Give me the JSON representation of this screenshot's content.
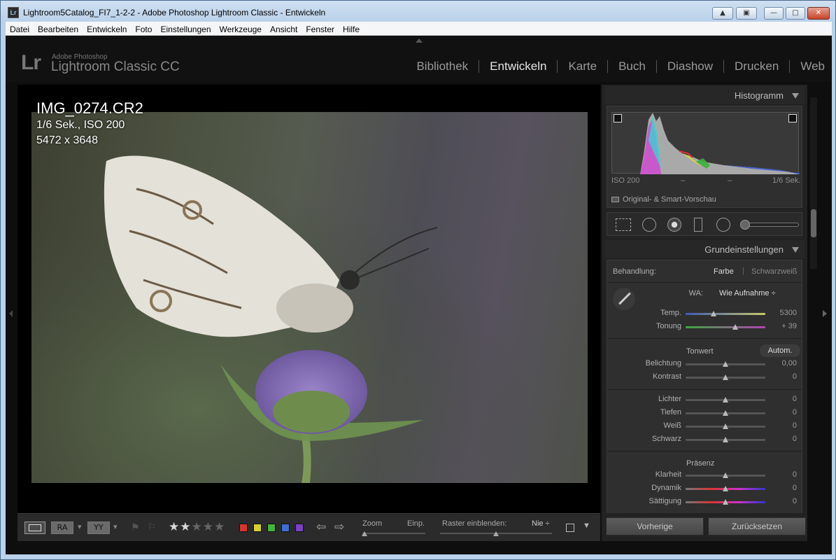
{
  "window": {
    "title": "Lightroom5Catalog_FI7_1-2-2 - Adobe Photoshop Lightroom Classic - Entwickeln",
    "icon_text": "Lr"
  },
  "menu": [
    "Datei",
    "Bearbeiten",
    "Entwickeln",
    "Foto",
    "Einstellungen",
    "Werkzeuge",
    "Ansicht",
    "Fenster",
    "Hilfe"
  ],
  "logo": {
    "mark": "Lr",
    "sub": "Adobe Photoshop",
    "name": "Lightroom Classic CC"
  },
  "modules": [
    "Bibliothek",
    "Entwickeln",
    "Karte",
    "Buch",
    "Diashow",
    "Drucken",
    "Web"
  ],
  "active_module": "Entwickeln",
  "photo_info": {
    "filename": "IMG_0274.CR2",
    "exposure": "1/6 Sek., ISO 200",
    "dimensions": "5472 x 3648"
  },
  "histogram": {
    "title": "Histogramm",
    "iso": "ISO 200",
    "dash1": "–",
    "dash2": "–",
    "shutter": "1/6 Sek.",
    "preview": "Original- & Smart-Vorschau"
  },
  "basic": {
    "title": "Grundeinstellungen",
    "treatment_label": "Behandlung:",
    "color": "Farbe",
    "bw": "Schwarzweiß",
    "wb_label": "WA:",
    "wb_value": "Wie Aufnahme ÷",
    "tone_label": "Tonwert",
    "auto": "Autom.",
    "presence_label": "Präsenz",
    "sliders": [
      {
        "label": "Temp.",
        "value": "5300",
        "pos": 0.35
      },
      {
        "label": "Tonung",
        "value": "+ 39",
        "pos": 0.62
      },
      {
        "label": "Belichtung",
        "value": "0,00",
        "pos": 0.5
      },
      {
        "label": "Kontrast",
        "value": "0",
        "pos": 0.5
      },
      {
        "label": "Lichter",
        "value": "0",
        "pos": 0.5
      },
      {
        "label": "Tiefen",
        "value": "0",
        "pos": 0.5
      },
      {
        "label": "Weiß",
        "value": "0",
        "pos": 0.5
      },
      {
        "label": "Schwarz",
        "value": "0",
        "pos": 0.5
      },
      {
        "label": "Klarheit",
        "value": "0",
        "pos": 0.5
      },
      {
        "label": "Dynamik",
        "value": "0",
        "pos": 0.5
      },
      {
        "label": "Sättigung",
        "value": "0",
        "pos": 0.5
      }
    ]
  },
  "toolbar": {
    "ra": "RA",
    "yy": "YY",
    "zoom": "Zoom",
    "fit": "Einp.",
    "grid": "Raster einblenden:",
    "grid_value": "Nie ÷",
    "rating": 2,
    "stars_total": 5
  },
  "color_labels": [
    "#d8352a",
    "#d8cf2a",
    "#43b33c",
    "#3d6fd1",
    "#7b3fc9"
  ],
  "buttons": {
    "previous": "Vorherige",
    "reset": "Zurücksetzen"
  }
}
